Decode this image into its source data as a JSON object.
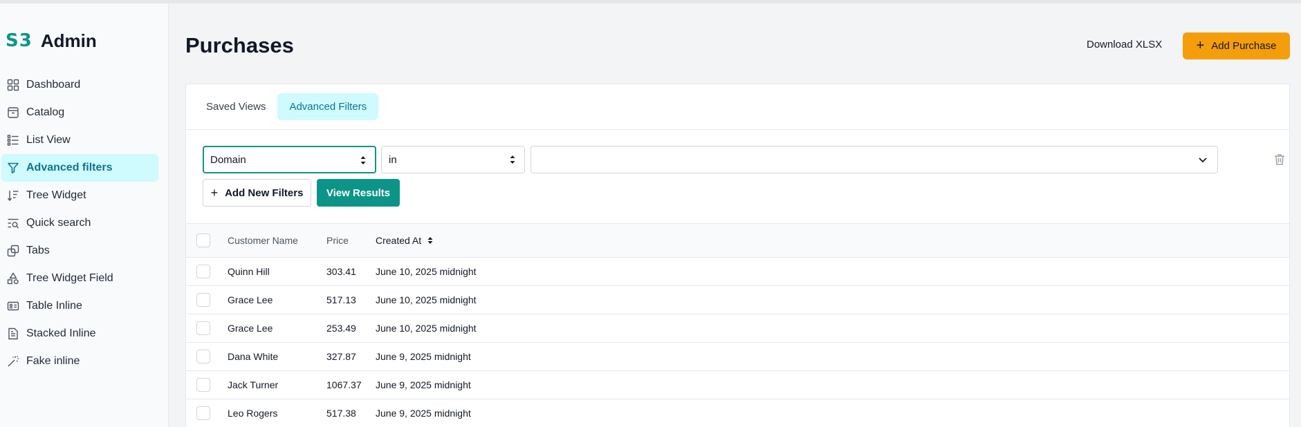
{
  "app": {
    "logo_mark": "S3",
    "logo_text": "Admin"
  },
  "sidebar": {
    "items": [
      {
        "label": "Dashboard",
        "icon": "grid-icon"
      },
      {
        "label": "Catalog",
        "icon": "archive-icon"
      },
      {
        "label": "List View",
        "icon": "list-icon"
      },
      {
        "label": "Advanced filters",
        "icon": "filter-icon",
        "active": true
      },
      {
        "label": "Tree Widget",
        "icon": "sort-list-icon"
      },
      {
        "label": "Quick search",
        "icon": "list-search-icon"
      },
      {
        "label": "Tabs",
        "icon": "copy-icon"
      },
      {
        "label": "Tree Widget Field",
        "icon": "shapes-icon"
      },
      {
        "label": "Table Inline",
        "icon": "id-card-icon"
      },
      {
        "label": "Stacked Inline",
        "icon": "file-stack-icon"
      },
      {
        "label": "Fake inline",
        "icon": "magic-wand-icon"
      }
    ]
  },
  "header": {
    "title": "Purchases",
    "download_label": "Download XLSX",
    "add_label": "Add Purchase",
    "accent_color": "#f59e0b"
  },
  "tabs": [
    {
      "label": "Saved Views"
    },
    {
      "label": "Advanced Filters",
      "active": true
    }
  ],
  "filters": {
    "field": "Domain",
    "operator": "in",
    "value": "",
    "add_label": "Add New Filters",
    "view_label": "View Results",
    "primary_color": "#0d9488"
  },
  "table": {
    "headers": {
      "name": "Customer Name",
      "price": "Price",
      "created": "Created At"
    },
    "rows": [
      {
        "name": "Quinn Hill",
        "price": "303.41",
        "created": "June 10, 2025 midnight"
      },
      {
        "name": "Grace Lee",
        "price": "517.13",
        "created": "June 10, 2025 midnight"
      },
      {
        "name": "Grace Lee",
        "price": "253.49",
        "created": "June 10, 2025 midnight"
      },
      {
        "name": "Dana White",
        "price": "327.87",
        "created": "June 9, 2025 midnight"
      },
      {
        "name": "Jack Turner",
        "price": "1067.37",
        "created": "June 9, 2025 midnight"
      },
      {
        "name": "Leo Rogers",
        "price": "517.38",
        "created": "June 9, 2025 midnight"
      }
    ]
  }
}
